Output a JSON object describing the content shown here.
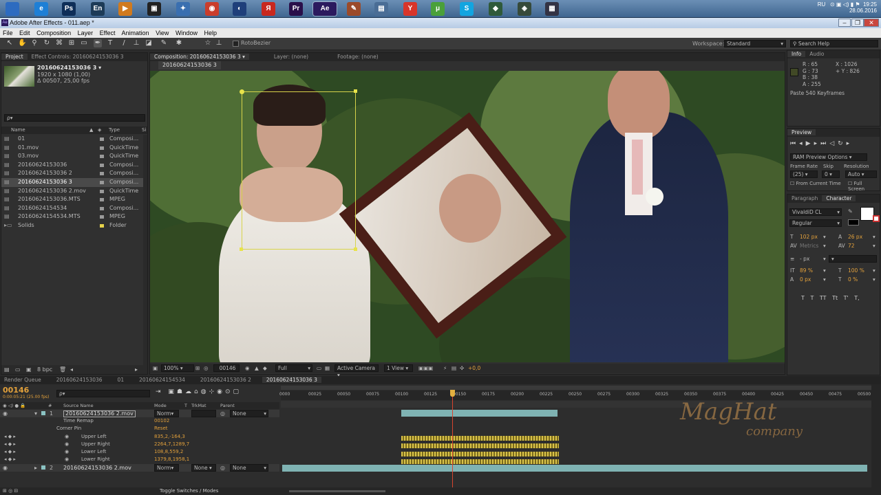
{
  "window": {
    "title": "Adobe After Effects - 011.aep *"
  },
  "tray": {
    "lang": "RU",
    "time": "19:25",
    "date": "28.06.2016"
  },
  "taskbar": {
    "items": [
      {
        "label": "",
        "icon": "windows-start-icon",
        "color": "#2d6bc0"
      },
      {
        "label": "e",
        "icon": "internet-explorer-icon",
        "color": "#1e7fd6"
      },
      {
        "label": "Ps",
        "icon": "photoshop-icon",
        "color": "#0e2e58"
      },
      {
        "label": "En",
        "icon": "encore-icon",
        "color": "#1d3b57"
      },
      {
        "label": "▶",
        "icon": "media-player-icon",
        "color": "#d07a1e"
      },
      {
        "label": "▣",
        "icon": "terminal-icon",
        "color": "#222222"
      },
      {
        "label": "✦",
        "icon": "network-icon",
        "color": "#3a6fb0"
      },
      {
        "label": "◉",
        "icon": "chrome-icon",
        "color": "#c93d2c"
      },
      {
        "label": "◐",
        "icon": "browser-icon",
        "color": "#1f3f7a"
      },
      {
        "label": "Я",
        "icon": "yandex-icon",
        "color": "#c8281e"
      },
      {
        "label": "Pr",
        "icon": "premiere-icon",
        "color": "#2a0f4a"
      },
      {
        "label": "Ae",
        "icon": "after-effects-icon",
        "color": "#2b1a5e"
      },
      {
        "label": "✎",
        "icon": "paint-icon",
        "color": "#9b4a2a"
      },
      {
        "label": "▤",
        "icon": "desktop-icon",
        "color": "#4a6d95"
      },
      {
        "label": "Y",
        "icon": "yandex-browser-icon",
        "color": "#d8352a"
      },
      {
        "label": "μ",
        "icon": "utorrent-icon",
        "color": "#4aa03a"
      },
      {
        "label": "S",
        "icon": "skype-icon",
        "color": "#12a5e0"
      },
      {
        "label": "◆",
        "icon": "app-icon",
        "color": "#2f5a3a"
      },
      {
        "label": "◈",
        "icon": "app-icon-2",
        "color": "#364a3a"
      },
      {
        "label": "▦",
        "icon": "grid-app-icon",
        "color": "#333344"
      }
    ]
  },
  "menu": [
    "File",
    "Edit",
    "Composition",
    "Layer",
    "Effect",
    "Animation",
    "View",
    "Window",
    "Help"
  ],
  "toolbar": {
    "rotobezier": "RotoBezier",
    "workspace_label": "Workspace:",
    "workspace": "Standard",
    "search": "Search Help"
  },
  "project": {
    "tabs": [
      "Project",
      "Effect Controls: 20160624153036 3"
    ],
    "item_name": "20160624153036 3 ▾",
    "item_dims": "1920 x 1080 (1,00)",
    "item_duration": "Δ 00507, 25,00 fps",
    "search_placeholder": "ρ▾",
    "col_name": "Name",
    "col_type": "Type",
    "items": [
      {
        "name": "01",
        "type": "Composi..."
      },
      {
        "name": "01.mov",
        "type": "QuickTime"
      },
      {
        "name": "03.mov",
        "type": "QuickTime"
      },
      {
        "name": "20160624153036",
        "type": "Composi..."
      },
      {
        "name": "20160624153036 2",
        "type": "Composi..."
      },
      {
        "name": "20160624153036 3",
        "type": "Composi..."
      },
      {
        "name": "20160624153036 2.mov",
        "type": "QuickTime"
      },
      {
        "name": "20160624153036.MTS",
        "type": "MPEG"
      },
      {
        "name": "20160624154534",
        "type": "Composi..."
      },
      {
        "name": "20160624154534.MTS",
        "type": "MPEG"
      },
      {
        "name": "Solids",
        "type": "Folder"
      }
    ],
    "bpc": "8 bpc"
  },
  "comp": {
    "tabs": [
      "Composition: 20160624153036 3 ▾",
      "Layer: (none)",
      "Footage: (none)"
    ],
    "sub_tab": "20160624153036 3",
    "zoom": "100%",
    "timecode": "00146",
    "resolution": "Full",
    "camera": "Active Camera",
    "views": "1 View",
    "exposure": "+0,0"
  },
  "info": {
    "tabs": [
      "Info",
      "Audio"
    ],
    "r": "R : 65",
    "g": "G : 73",
    "b": "B : 38",
    "a": "A : 255",
    "x": "X : 1026",
    "y": "+ Y : 826",
    "message": "Paste 540 Keyframes"
  },
  "preview": {
    "tab": "Preview",
    "ram": "RAM Preview Options",
    "frame_rate_label": "Frame Rate",
    "skip_label": "Skip",
    "resolution_label": "Resolution",
    "frame_rate": "(25)",
    "skip": "0",
    "resolution": "Auto",
    "from_current": "From Current Time",
    "full_screen": "Full Screen"
  },
  "character": {
    "tabs": [
      "Paragraph",
      "Character"
    ],
    "font": "VivaldiD CL",
    "style": "Regular",
    "size": "102 px",
    "leading": "26 px",
    "kerning": "Metrics",
    "tracking": "72",
    "stroke": "- px",
    "vscale": "89 %",
    "hscale": "100 %",
    "baseline": "0 px",
    "tsume": "0 %",
    "styles": [
      "T",
      "T",
      "TT",
      "Tt",
      "T'",
      "T,"
    ]
  },
  "timeline_tabs": [
    "Render Queue",
    "20160624153036",
    "01",
    "20160624154534",
    "20160624153036 2",
    "20160624153036 3"
  ],
  "timeline": {
    "timecode": "00146",
    "timecode_sub": "0:00:05:21 (25.00 fps)",
    "search_placeholder": "ρ▾",
    "col_source": "Source Name",
    "col_mode": "Mode",
    "col_t": "T",
    "col_trkmat": "TrkMat",
    "col_parent": "Parent",
    "rulers": [
      "0000",
      "00025",
      "00050",
      "00075",
      "00100",
      "00125",
      "00150",
      "00175",
      "00200",
      "00225",
      "00250",
      "00275",
      "00300",
      "00325",
      "00350",
      "00375",
      "00400",
      "00425",
      "00450",
      "00475",
      "00500"
    ],
    "layers": [
      {
        "num": "1",
        "name": "20160624153036 2.mov",
        "mode": "Norm▾",
        "trkmat": "",
        "parent": "None"
      },
      {
        "num": "2",
        "name": "20160624153036 2.mov",
        "mode": "Norm▾",
        "trkmat": "None",
        "parent": "None"
      }
    ],
    "props": [
      {
        "label": "Time Remap",
        "value": "00102"
      },
      {
        "label": "Corner Pin",
        "value": "Reset"
      },
      {
        "label": "Upper Left",
        "value": "835,2,-164,3"
      },
      {
        "label": "Upper Right",
        "value": "2264,7,1289,7"
      },
      {
        "label": "Lower Left",
        "value": "108,8,559,2"
      },
      {
        "label": "Lower Right",
        "value": "1379,8,1958,1"
      }
    ],
    "toggle": "Toggle Switches / Modes",
    "playhead": 146,
    "duration": 507
  },
  "watermark": {
    "line1": "MagHat",
    "line2": "company"
  }
}
